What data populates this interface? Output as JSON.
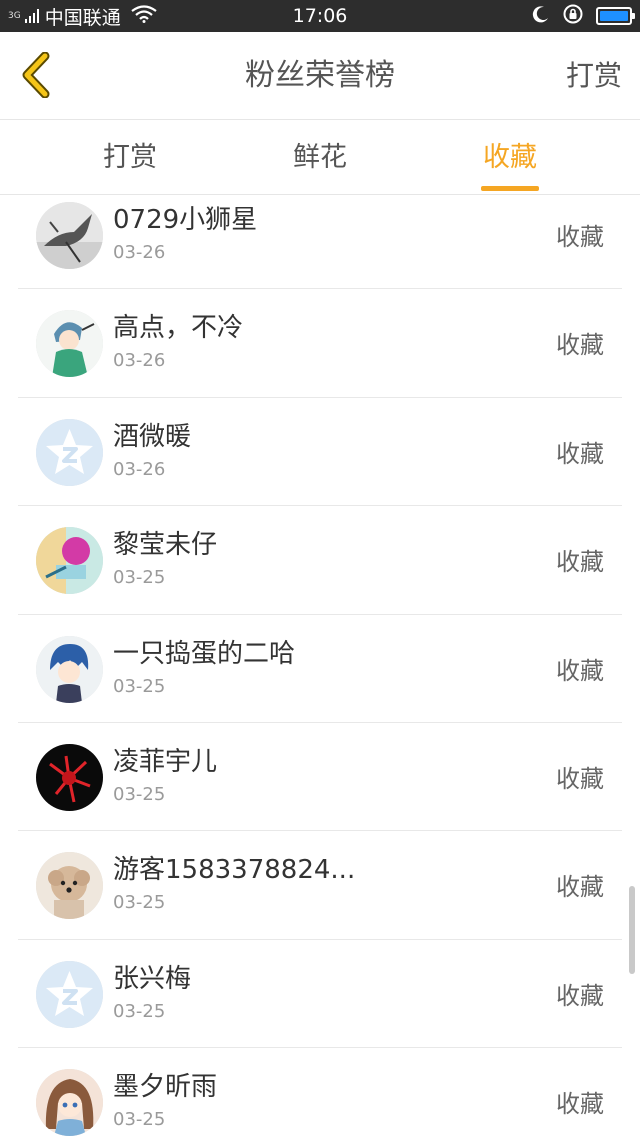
{
  "status_bar": {
    "network": "3G",
    "carrier": "中国联通",
    "time": "17:06"
  },
  "header": {
    "title": "粉丝荣誉榜",
    "right_action": "打赏"
  },
  "tabs": [
    {
      "label": "打赏"
    },
    {
      "label": "鲜花"
    },
    {
      "label": "收藏"
    }
  ],
  "active_tab": "收藏",
  "accent_color": "#f5a623",
  "list": [
    {
      "name": "0729小狮星",
      "date": "03-26",
      "type": "收藏",
      "avatar": "photo-bird"
    },
    {
      "name": "高点，不冷",
      "date": "03-26",
      "type": "收藏",
      "avatar": "anime-boy"
    },
    {
      "name": "酒微暖",
      "date": "03-26",
      "type": "收藏",
      "avatar": "default-star"
    },
    {
      "name": "黎莹未仔",
      "date": "03-25",
      "type": "收藏",
      "avatar": "colorful-art"
    },
    {
      "name": "一只捣蛋的二哈",
      "date": "03-25",
      "type": "收藏",
      "avatar": "anime-blue-hair"
    },
    {
      "name": "凌菲宇儿",
      "date": "03-25",
      "type": "收藏",
      "avatar": "red-flower"
    },
    {
      "name": "游客1583378824...",
      "date": "03-25",
      "type": "收藏",
      "avatar": "dog-photo"
    },
    {
      "name": "张兴梅",
      "date": "03-25",
      "type": "收藏",
      "avatar": "default-star"
    },
    {
      "name": "墨夕昕雨",
      "date": "03-25",
      "type": "收藏",
      "avatar": "anime-girl"
    }
  ]
}
